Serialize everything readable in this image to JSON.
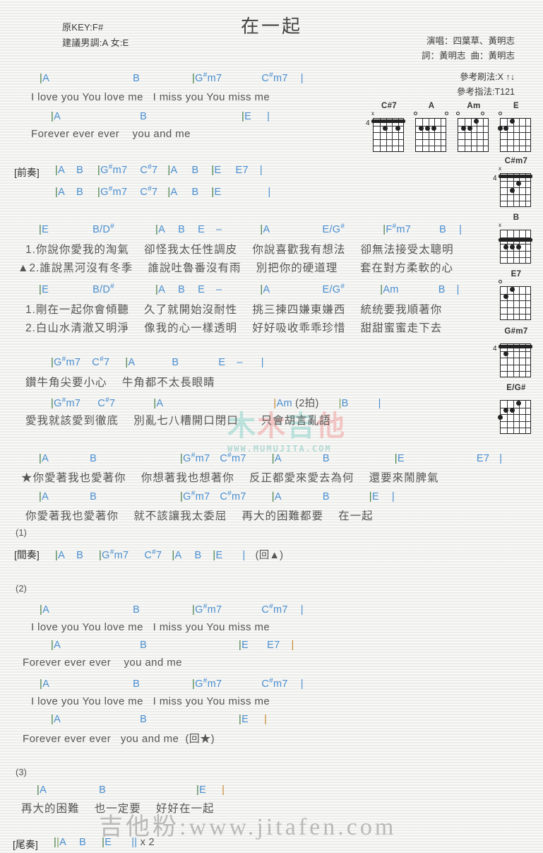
{
  "page": {
    "bg": "#f2f2f0",
    "chord_color": "#4a8fd0",
    "text_color": "#555555"
  },
  "header": {
    "key_line": "原KEY:F#",
    "suggest_line": "建議男調:A 女:E",
    "title": "在一起",
    "singer": "演唱：四葉草、黃明志",
    "writer": "詞：黃明志  曲：黃明志",
    "strum": "參考刷法:X ↑↓",
    "fingering": "參考指法:T121"
  },
  "intro_block": {
    "l1_chords": [
      "|A",
      "B",
      "|G#m7",
      "C#m7",
      "|"
    ],
    "l1_lyric": "I love you You love me   I miss you You miss me",
    "l2_chords": [
      "|A",
      "B",
      "|E",
      "|"
    ],
    "l2_lyric": "Forever ever ever    you and me"
  },
  "prelude": {
    "label": "[前奏]",
    "line1": "|A  B  |G#m7   C#7  |A   B  |E   E7  |",
    "line2": "|A  B  |G#m7   C#7  |A   B  |E              |"
  },
  "verse1": {
    "chords": "|E        B/D#        |A  B  E  –        |A        E/G#        |F#m7      B  |",
    "lyric1": "1.你說你愛我的淘氣    卻怪我太任性調皮    你說喜歡我有想法    卻無法接受太聰明",
    "lyric2": "▲2.誰說黑河沒有冬季    誰說吐魯番沒有雨    別把你的硬道理      套在對方柔軟的心"
  },
  "verse2": {
    "chords": "|E        B/D#        |A  B  E  –        |A        E/G#        |Am        B  |",
    "lyric1": "1.剛在一起你會傾聽    久了就開始沒耐性    挑三揀四嫌東嫌西    統统要我順著你",
    "lyric2": "2.白山水清澈又明淨    像我的心一樣透明    好好吸收乖乖珍惜    甜甜蜜蜜走下去"
  },
  "pre_chorus": {
    "l1_chords": "|G#m7   C#7   |A       B       E  –   |",
    "l1_lyric": "鑽牛角尖要小心    牛角都不太長眼睛",
    "l2_chords": "|G#m7    C#7      |A                              |Am (2拍)     |B       |",
    "l2_lyric": "愛我就該愛到徹底    別亂七八糟開口閉口      只會胡言亂語"
  },
  "chorus": {
    "l1_chords": "|A       B            |G#m7   C#m7   |A       B           |E            E7  |",
    "l1_lyric": "★你愛著我也愛著你    你想著我也想著你    反正都愛來愛去為何    還要來鬧脾氣",
    "l2_chords": "|A       B            |G#m7   C#m7   |A       B        |E   |",
    "l2_lyric": "你愛著我也愛著你    就不該讓我太委屈    再大的困難都要    在一起"
  },
  "marker1": "(1)",
  "interlude": {
    "label": "[間奏]",
    "chords": "|A  B   |G#m7   C#7  |A  B  |E    |  (回▲)"
  },
  "marker2": "(2)",
  "outro_block": {
    "l1_chords": [
      "|A",
      "B",
      "|G#m7",
      "C#m7",
      "|"
    ],
    "l1_lyric": "I love you You love me   I miss you You miss me",
    "l2_chords": [
      "|A",
      "B",
      "|E",
      "E7",
      "|"
    ],
    "l2_lyric": "Forever ever ever    you and me",
    "l3_chords": [
      "|A",
      "B",
      "|G#m7",
      "C#m7",
      "|"
    ],
    "l3_lyric": "I love you You love me   I miss you You miss me",
    "l4_chords": [
      "|A",
      "B",
      "|E",
      "|"
    ],
    "l4_lyric": "Forever ever ever   you and me  (回★)"
  },
  "marker3": "(3)",
  "final": {
    "chords": "|A           B                        |E   |",
    "lyric": "再大的困難    也一定要    好好在一起"
  },
  "coda": {
    "label": "[尾奏]",
    "chords": "||A   B   |E     || x 2"
  },
  "watermarks": {
    "mumu_cn": "木木吉他",
    "mumu_url": "WWW.MUMUJITA.COM",
    "bottom": "吉他粉:www.jitafen.com"
  },
  "chord_diagrams_top": [
    {
      "name": "C#7",
      "fret_label": "4",
      "markers": [
        "x",
        "",
        "",
        "",
        "",
        ""
      ],
      "barre": {
        "from": 0,
        "to": 5,
        "fret": 1
      },
      "dots": [
        {
          "string": 2,
          "fret": 2
        },
        {
          "string": 4,
          "fret": 2
        }
      ]
    },
    {
      "name": "A",
      "fret_label": "",
      "markers": [
        "o",
        "",
        "",
        "",
        "",
        "o"
      ],
      "barre": null,
      "dots": [
        {
          "string": 1,
          "fret": 2
        },
        {
          "string": 2,
          "fret": 2
        },
        {
          "string": 3,
          "fret": 2
        }
      ]
    },
    {
      "name": "Am",
      "fret_label": "",
      "markers": [
        "o",
        "",
        "",
        "",
        "o",
        ""
      ],
      "barre": null,
      "dots": [
        {
          "string": 3,
          "fret": 1
        },
        {
          "string": 1,
          "fret": 2
        },
        {
          "string": 2,
          "fret": 2
        }
      ]
    },
    {
      "name": "E",
      "fret_label": "",
      "markers": [
        "o",
        "",
        "",
        "",
        "",
        ""
      ],
      "barre": null,
      "dots": [
        {
          "string": 2,
          "fret": 1
        },
        {
          "string": 0,
          "fret": 2
        },
        {
          "string": 1,
          "fret": 2
        }
      ]
    }
  ],
  "chord_diagrams_side": [
    {
      "name": "C#m7",
      "fret_label": "4",
      "markers": [
        "x",
        "",
        "",
        "",
        "",
        ""
      ],
      "barre": {
        "from": 0,
        "to": 5,
        "fret": 1
      },
      "dots": [
        {
          "string": 3,
          "fret": 2
        },
        {
          "string": 2,
          "fret": 3
        }
      ]
    },
    {
      "name": "B",
      "fret_label": "",
      "markers": [
        "x",
        "",
        "",
        "",
        "",
        ""
      ],
      "barre": {
        "from": 0,
        "to": 5,
        "fret": 2
      },
      "dots": [
        {
          "string": 1,
          "fret": 3
        },
        {
          "string": 2,
          "fret": 3
        },
        {
          "string": 3,
          "fret": 3
        }
      ]
    },
    {
      "name": "E7",
      "fret_label": "",
      "markers": [
        "o",
        "",
        "",
        "",
        "",
        ""
      ],
      "barre": null,
      "dots": [
        {
          "string": 2,
          "fret": 1
        },
        {
          "string": 1,
          "fret": 2
        }
      ]
    },
    {
      "name": "G#m7",
      "fret_label": "4",
      "markers": [
        "",
        "",
        "",
        "",
        "",
        ""
      ],
      "barre": {
        "from": 0,
        "to": 5,
        "fret": 1
      },
      "dots": [
        {
          "string": 1,
          "fret": 2
        }
      ]
    },
    {
      "name": "E/G#",
      "fret_label": "",
      "markers": [
        "",
        "",
        "",
        "",
        "",
        ""
      ],
      "barre": null,
      "dots": [
        {
          "string": 3,
          "fret": 1
        },
        {
          "string": 1,
          "fret": 2
        },
        {
          "string": 2,
          "fret": 2
        },
        {
          "string": 0,
          "fret": 3
        }
      ]
    }
  ]
}
